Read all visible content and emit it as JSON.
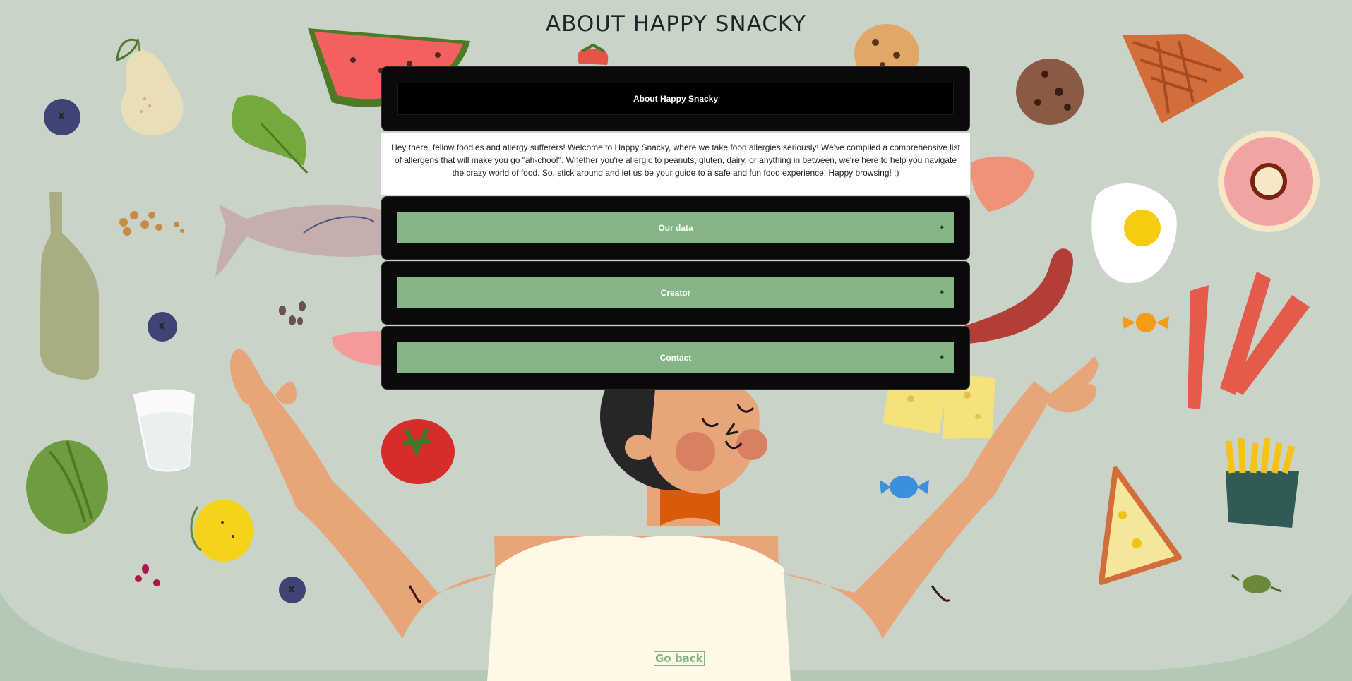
{
  "page": {
    "title": "ABOUT HAPPY SNACKY"
  },
  "about": {
    "header": "About Happy Snacky",
    "intro": "Hey there, fellow foodies and allergy sufferers! Welcome to Happy Snacky, where we take food allergies seriously! We've compiled a comprehensive list of allergens that will make you go \"ah-choo!\". Whether you're allergic to peanuts, gluten, dairy, or anything in between, we're here to help you navigate the crazy world of food. So, stick around and let us be your guide to a safe and fun food experience. Happy browsing! ;)"
  },
  "accordion": [
    {
      "label": "Our data",
      "toggle": "+"
    },
    {
      "label": "Creator",
      "toggle": "+"
    },
    {
      "label": "Contact",
      "toggle": "+"
    }
  ],
  "nav": {
    "go_back": "Go back"
  },
  "colors": {
    "background": "#c9d3c8",
    "accent_green": "#85b586",
    "panel_black": "#0a0a0a"
  }
}
